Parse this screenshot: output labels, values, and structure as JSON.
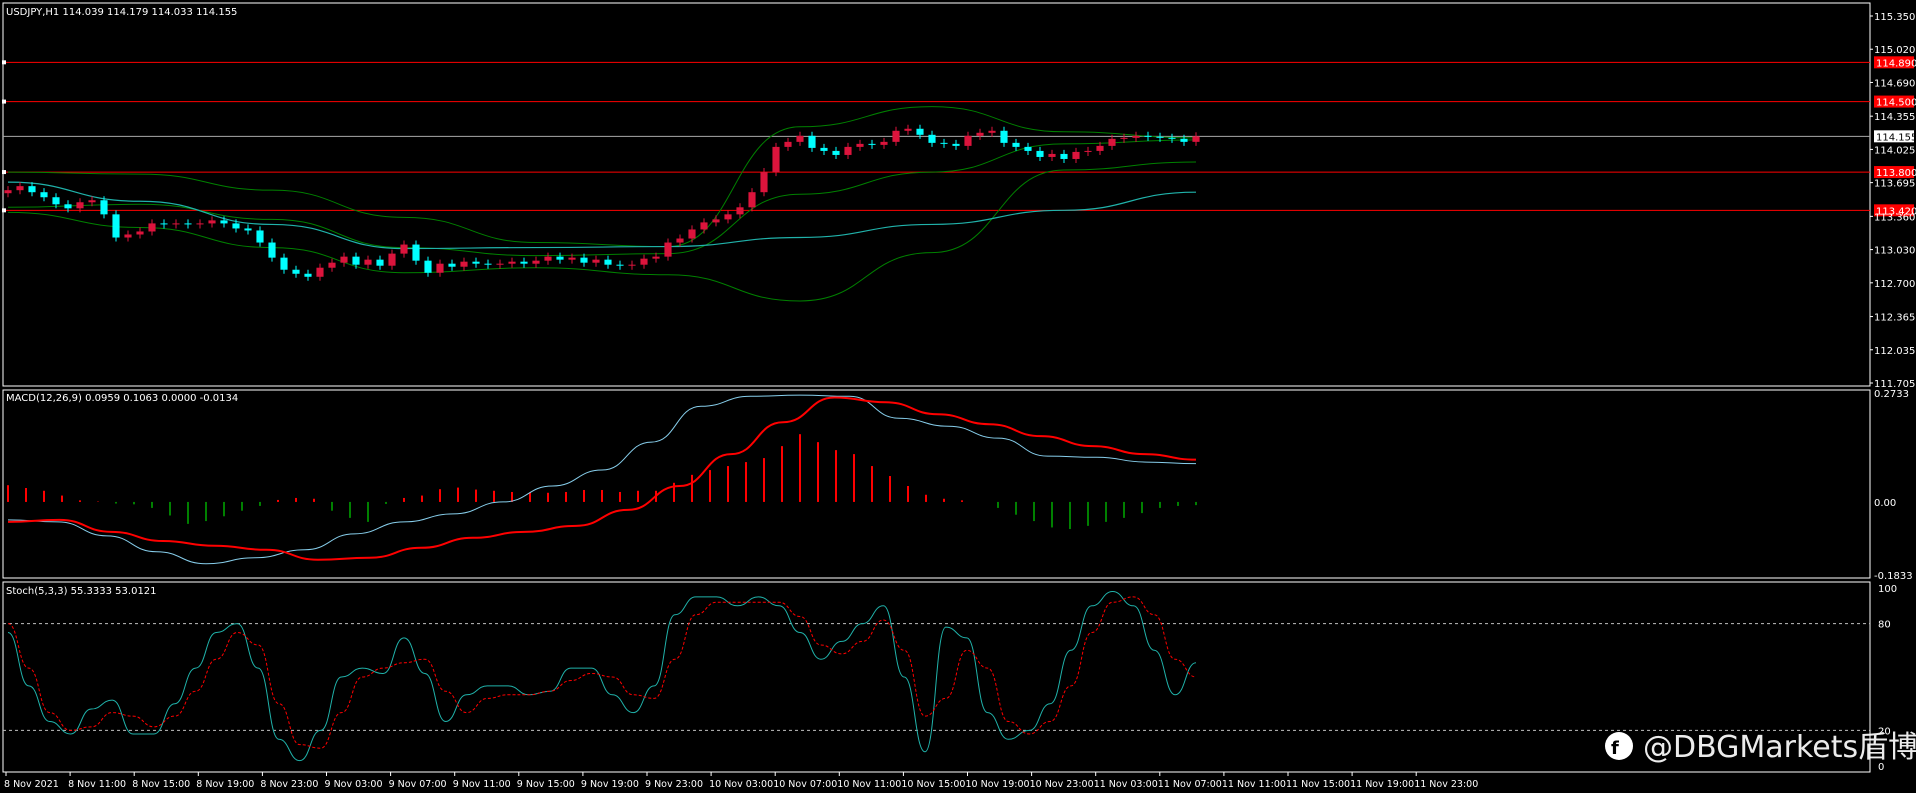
{
  "header": {
    "main": "USDJPY,H1  114.039 114.179 114.033 114.155",
    "macd": "MACD(12,26,9) 0.0959 0.1063 0.0000 -0.0134",
    "stoch": "Stoch(5,3,3) 55.3333 53.0121"
  },
  "watermark": "@DBGMarkets盾博",
  "colors": {
    "bull": "#00ffff",
    "bear": "#dc143c",
    "bands": "#008000",
    "ma": "#20b2aa",
    "hline": "#ff0000",
    "macd_line": "#87ceeb",
    "signal": "#ff0000",
    "hist_pos": "#ff0000",
    "hist_neg": "#008000",
    "stoch_main": "#20b2aa",
    "stoch_signal": "#ff0000"
  },
  "chart_data": [
    {
      "type": "candlestick",
      "symbol": "USDJPY",
      "timeframe": "H1",
      "ylim": [
        111.705,
        115.35
      ],
      "y_ticks": [
        "115.350",
        "115.020",
        "114.690",
        "114.355",
        "114.025",
        "113.695",
        "113.360",
        "113.030",
        "112.700",
        "112.365",
        "112.035",
        "111.705"
      ],
      "x_ticks": [
        "8 Nov 2021",
        "8 Nov 11:00",
        "8 Nov 15:00",
        "8 Nov 19:00",
        "8 Nov 23:00",
        "9 Nov 03:00",
        "9 Nov 07:00",
        "9 Nov 11:00",
        "9 Nov 15:00",
        "9 Nov 19:00",
        "9 Nov 23:00",
        "10 Nov 03:00",
        "10 Nov 07:00",
        "10 Nov 11:00",
        "10 Nov 15:00",
        "10 Nov 19:00",
        "10 Nov 23:00",
        "11 Nov 03:00",
        "11 Nov 07:00",
        "11 Nov 11:00",
        "11 Nov 15:00",
        "11 Nov 19:00",
        "11 Nov 23:00"
      ],
      "current_price": "114.155",
      "horizontal_lines": [
        {
          "price": 114.89,
          "label": "114.890"
        },
        {
          "price": 114.5,
          "label": "114.500"
        },
        {
          "price": 113.8,
          "label": "113.800"
        },
        {
          "price": 113.42,
          "label": "113.420"
        }
      ],
      "closes": [
        113.62,
        113.66,
        113.6,
        113.55,
        113.48,
        113.44,
        113.5,
        113.52,
        113.38,
        113.15,
        113.18,
        113.21,
        113.29,
        113.28,
        113.29,
        113.28,
        113.29,
        113.32,
        113.29,
        113.24,
        113.22,
        113.1,
        112.95,
        112.83,
        112.79,
        112.76,
        112.85,
        112.9,
        112.96,
        112.88,
        112.93,
        112.87,
        112.99,
        113.08,
        112.92,
        112.8,
        112.89,
        112.86,
        112.91,
        112.89,
        112.88,
        112.89,
        112.91,
        112.89,
        112.92,
        112.96,
        112.93,
        112.95,
        112.9,
        112.93,
        112.88,
        112.87,
        112.88,
        112.94,
        112.96,
        113.1,
        113.14,
        113.23,
        113.3,
        113.33,
        113.38,
        113.45,
        113.6,
        113.8,
        114.05,
        114.1,
        114.16,
        114.04,
        114.01,
        113.97,
        114.05,
        114.08,
        114.07,
        114.1,
        114.21,
        114.23,
        114.17,
        114.09,
        114.08,
        114.06,
        114.16,
        114.19,
        114.21,
        114.09,
        114.05,
        114.01,
        113.95,
        113.98,
        113.93,
        114.0,
        114.01,
        114.06,
        114.13,
        114.14,
        114.16,
        114.15,
        114.14,
        114.13,
        114.1,
        114.155
      ],
      "ma_line": [
        113.7,
        113.51,
        113.28,
        113.04,
        113.05,
        113.06,
        113.15,
        113.28,
        113.42,
        113.6
      ],
      "bollinger_upper": [
        113.8,
        113.78,
        113.62,
        113.35,
        113.1,
        113.06,
        114.25,
        114.45,
        114.2,
        114.14
      ],
      "bollinger_middle": [
        113.45,
        113.48,
        113.33,
        113.05,
        112.97,
        112.99,
        113.58,
        113.8,
        114.08,
        114.12
      ],
      "bollinger_lower": [
        113.4,
        113.25,
        113.05,
        112.8,
        112.85,
        112.78,
        112.52,
        113.0,
        113.82,
        113.9
      ]
    },
    {
      "type": "macd",
      "params": "12,26,9",
      "ylim": [
        -0.1833,
        0.2733
      ],
      "y_ticks": [
        "0.2733",
        "0.00",
        "-0.1833"
      ],
      "macd": [
        -0.045,
        -0.05,
        -0.085,
        -0.125,
        -0.155,
        -0.14,
        -0.12,
        -0.08,
        -0.05,
        -0.03,
        0.0,
        0.04,
        0.08,
        0.15,
        0.24,
        0.265,
        0.268,
        0.265,
        0.21,
        0.19,
        0.16,
        0.115,
        0.112,
        0.1,
        0.096
      ],
      "signal": [
        -0.05,
        -0.045,
        -0.075,
        -0.098,
        -0.11,
        -0.12,
        -0.145,
        -0.14,
        -0.115,
        -0.09,
        -0.075,
        -0.06,
        -0.02,
        0.04,
        0.12,
        0.2,
        0.262,
        0.25,
        0.22,
        0.195,
        0.165,
        0.14,
        0.12,
        0.106
      ],
      "histogram": [
        0.042,
        0.035,
        0.028,
        0.016,
        0.004,
        0.001,
        -0.004,
        -0.006,
        -0.015,
        -0.034,
        -0.055,
        -0.048,
        -0.036,
        -0.022,
        -0.01,
        0.005,
        0.01,
        0.008,
        -0.022,
        -0.04,
        -0.05,
        -0.005,
        0.01,
        0.016,
        0.032,
        0.036,
        0.031,
        0.028,
        0.025,
        0.024,
        0.023,
        0.025,
        0.03,
        0.03,
        0.025,
        0.028,
        0.028,
        0.048,
        0.068,
        0.08,
        0.09,
        0.1,
        0.11,
        0.14,
        0.17,
        0.15,
        0.13,
        0.12,
        0.09,
        0.065,
        0.04,
        0.018,
        0.008,
        0.004,
        0.0,
        -0.015,
        -0.032,
        -0.048,
        -0.064,
        -0.068,
        -0.06,
        -0.05,
        -0.04,
        -0.028,
        -0.015,
        -0.01,
        -0.008
      ]
    },
    {
      "type": "stochastic",
      "params": "5,3,3",
      "ylim": [
        0,
        100
      ],
      "y_ticks": [
        "100",
        "80",
        "20",
        "0"
      ],
      "levels": [
        80,
        20
      ],
      "k": [
        75,
        45,
        25,
        18,
        32,
        37,
        18,
        18,
        35,
        55,
        75,
        80,
        55,
        15,
        3,
        20,
        50,
        55,
        52,
        72,
        52,
        25,
        40,
        45,
        45,
        40,
        42,
        55,
        55,
        40,
        30,
        45,
        85,
        95,
        95,
        90,
        95,
        90,
        75,
        60,
        70,
        80,
        90,
        50,
        8,
        78,
        72,
        30,
        15,
        20,
        35,
        65,
        90,
        98,
        90,
        65,
        40,
        58
      ],
      "d": [
        80,
        55,
        30,
        20,
        22,
        30,
        28,
        22,
        28,
        42,
        60,
        75,
        68,
        35,
        12,
        10,
        30,
        50,
        55,
        58,
        60,
        42,
        30,
        38,
        40,
        40,
        42,
        48,
        52,
        50,
        40,
        38,
        60,
        85,
        92,
        92,
        92,
        92,
        84,
        68,
        63,
        70,
        82,
        65,
        28,
        38,
        65,
        55,
        25,
        18,
        25,
        45,
        75,
        92,
        95,
        85,
        60,
        50
      ]
    }
  ]
}
